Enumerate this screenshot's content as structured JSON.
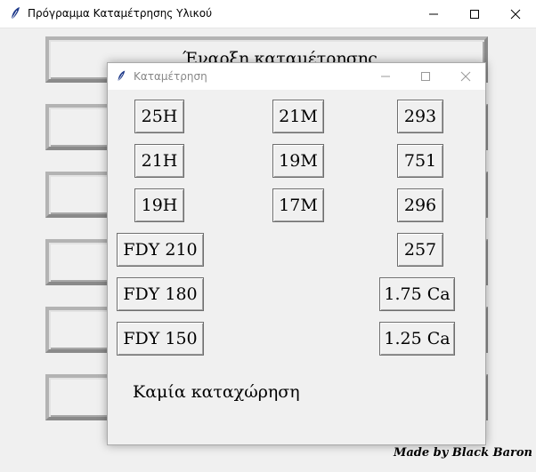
{
  "main_window": {
    "title": "Πρόγραμμα Καταμέτρησης Υλικού",
    "buttons": [
      {
        "label": "Έναρξη καταμέτρησης"
      },
      {
        "label": ""
      },
      {
        "label": ""
      },
      {
        "label": ""
      },
      {
        "label": ""
      },
      {
        "label": ""
      }
    ],
    "credit": "Made by Black Baron"
  },
  "dialog": {
    "title": "Καταμέτρηση",
    "buttons": {
      "b25h": "25H",
      "b21h": "21H",
      "b19h": "19H",
      "b21m": "21M",
      "b19m": "19M",
      "b17m": "17M",
      "b293": "293",
      "b751": "751",
      "b296": "296",
      "b257": "257",
      "fdy210": "FDY 210",
      "fdy180": "FDY 180",
      "fdy150": "FDY 150",
      "ca175": "1.75 Ca",
      "ca125": "1.25 Ca"
    },
    "status": "Καμία καταχώρηση"
  },
  "icons": {
    "app": "feather-icon",
    "minimize": "minimize-icon",
    "maximize": "maximize-icon",
    "close": "close-icon"
  }
}
